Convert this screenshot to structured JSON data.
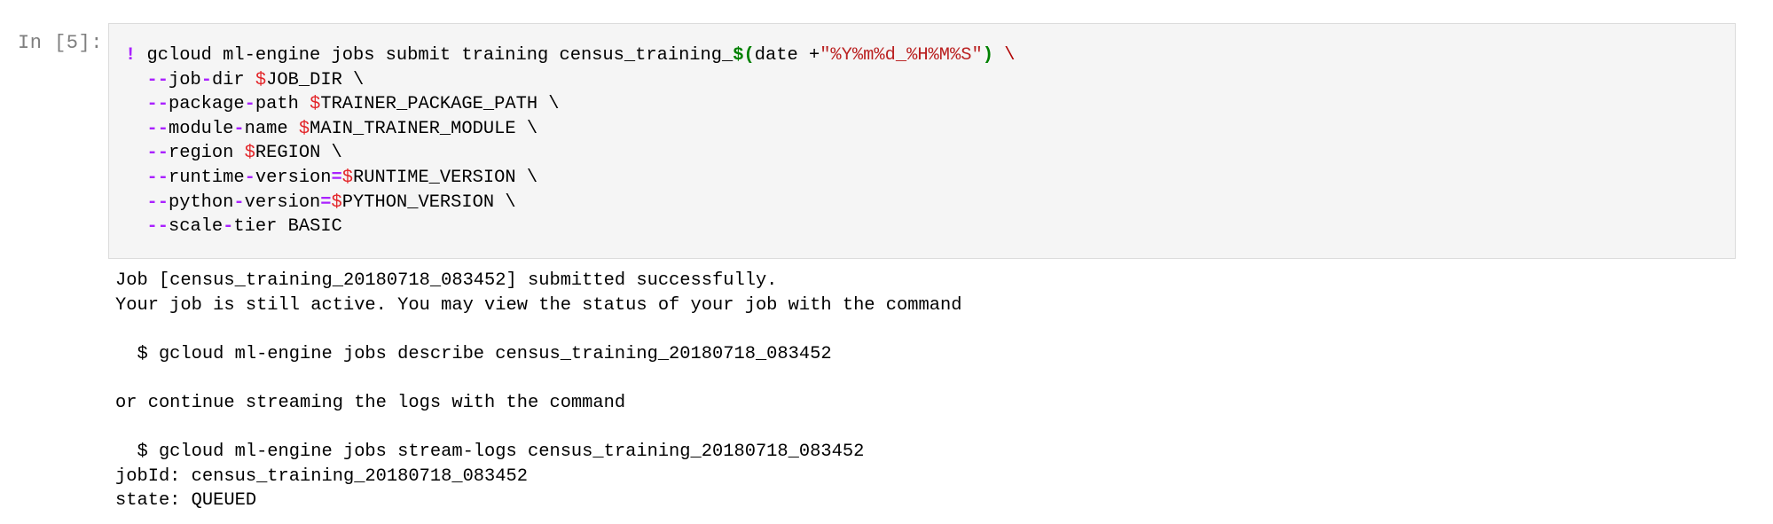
{
  "cell": {
    "prompt": "In [5]:"
  },
  "code": {
    "line1": {
      "bang": "!",
      "cmd": " gcloud ml-engine jobs submit training census_training_",
      "dollar": "$",
      "open": "(",
      "date": "date +",
      "fmt": "\"%Y%m%d_%H%M%S\"",
      "close": ")",
      "cont": " \\"
    },
    "args": [
      {
        "d1": "--",
        "w1": "job",
        "d2": "-",
        "w2": "dir",
        "sep": " ",
        "eq": "",
        "dollar": "$",
        "val": "JOB_DIR",
        "cont": " \\"
      },
      {
        "d1": "--",
        "w1": "package",
        "d2": "-",
        "w2": "path",
        "sep": " ",
        "eq": "",
        "dollar": "$",
        "val": "TRAINER_PACKAGE_PATH",
        "cont": " \\"
      },
      {
        "d1": "--",
        "w1": "module",
        "d2": "-",
        "w2": "name",
        "sep": " ",
        "eq": "",
        "dollar": "$",
        "val": "MAIN_TRAINER_MODULE",
        "cont": " \\"
      },
      {
        "d1": "--",
        "w1": "region",
        "d2": "",
        "w2": "",
        "sep": " ",
        "eq": "",
        "dollar": "$",
        "val": "REGION",
        "cont": " \\"
      },
      {
        "d1": "--",
        "w1": "runtime",
        "d2": "-",
        "w2": "version",
        "sep": "",
        "eq": "=",
        "dollar": "$",
        "val": "RUNTIME_VERSION",
        "cont": " \\"
      },
      {
        "d1": "--",
        "w1": "python",
        "d2": "-",
        "w2": "version",
        "sep": "",
        "eq": "=",
        "dollar": "$",
        "val": "PYTHON_VERSION",
        "cont": " \\"
      },
      {
        "d1": "--",
        "w1": "scale",
        "d2": "-",
        "w2": "tier",
        "sep": " ",
        "eq": "",
        "dollar": "",
        "val": "BASIC",
        "cont": ""
      }
    ]
  },
  "output": {
    "lines": [
      "Job [census_training_20180718_083452] submitted successfully.",
      "Your job is still active. You may view the status of your job with the command",
      "",
      "  $ gcloud ml-engine jobs describe census_training_20180718_083452",
      "",
      "or continue streaming the logs with the command",
      "",
      "  $ gcloud ml-engine jobs stream-logs census_training_20180718_083452",
      "jobId: census_training_20180718_083452",
      "state: QUEUED"
    ]
  }
}
